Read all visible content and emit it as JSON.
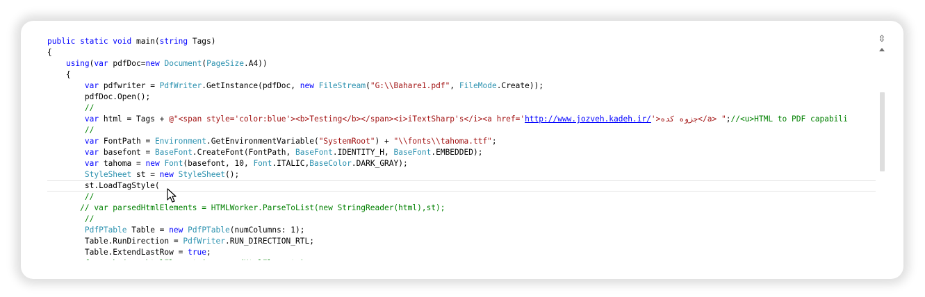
{
  "editor": {
    "lines": [
      [
        {
          "t": "public static void",
          "c": "kw"
        },
        {
          "t": " main("
        },
        {
          "t": "string",
          "c": "kw"
        },
        {
          "t": " Tags)"
        }
      ],
      [
        {
          "t": "{"
        }
      ],
      [
        {
          "t": "    "
        },
        {
          "t": "using",
          "c": "kw"
        },
        {
          "t": "("
        },
        {
          "t": "var",
          "c": "kw"
        },
        {
          "t": " pdfDoc="
        },
        {
          "t": "new",
          "c": "kw"
        },
        {
          "t": " "
        },
        {
          "t": "Document",
          "c": "ty"
        },
        {
          "t": "("
        },
        {
          "t": "PageSize",
          "c": "ty"
        },
        {
          "t": ".A4))"
        }
      ],
      [
        {
          "t": "    {"
        }
      ],
      [
        {
          "t": "        "
        },
        {
          "t": "var",
          "c": "kw"
        },
        {
          "t": " pdfwriter = "
        },
        {
          "t": "PdfWriter",
          "c": "ty"
        },
        {
          "t": ".GetInstance(pdfDoc, "
        },
        {
          "t": "new",
          "c": "kw"
        },
        {
          "t": " "
        },
        {
          "t": "FileStream",
          "c": "ty"
        },
        {
          "t": "("
        },
        {
          "t": "\"G:\\\\Bahare1.pdf\"",
          "c": "str"
        },
        {
          "t": ", "
        },
        {
          "t": "FileMode",
          "c": "ty"
        },
        {
          "t": ".Create));"
        }
      ],
      [
        {
          "t": "        pdfDoc.Open();"
        }
      ],
      [
        {
          "t": "        "
        },
        {
          "t": "//",
          "c": "cm"
        }
      ],
      [
        {
          "t": "        "
        },
        {
          "t": "var",
          "c": "kw"
        },
        {
          "t": " html = Tags + "
        },
        {
          "t": "@\"<span style='color:blue'><b>Testing</b></span><i>iTextSharp's</i><a href='",
          "c": "str"
        },
        {
          "t": "http://www.jozveh.kadeh.ir/",
          "c": "lnk"
        },
        {
          "t": "'>جزوه کده</a> \"",
          "c": "str"
        },
        {
          "t": ";"
        },
        {
          "t": "//<u>HTML to PDF capabili",
          "c": "cm"
        }
      ],
      [
        {
          "t": "        "
        },
        {
          "t": "//",
          "c": "cm"
        }
      ],
      [
        {
          "t": "        "
        },
        {
          "t": "var",
          "c": "kw"
        },
        {
          "t": " FontPath = "
        },
        {
          "t": "Environment",
          "c": "ty"
        },
        {
          "t": ".GetEnvironmentVariable("
        },
        {
          "t": "\"SystemRoot\"",
          "c": "str"
        },
        {
          "t": ") + "
        },
        {
          "t": "\"\\\\fonts\\\\tahoma.ttf\"",
          "c": "str"
        },
        {
          "t": ";"
        }
      ],
      [
        {
          "t": "        "
        },
        {
          "t": "var",
          "c": "kw"
        },
        {
          "t": " basefont = "
        },
        {
          "t": "BaseFont",
          "c": "ty"
        },
        {
          "t": ".CreateFont(FontPath, "
        },
        {
          "t": "BaseFont",
          "c": "ty"
        },
        {
          "t": ".IDENTITY_H, "
        },
        {
          "t": "BaseFont",
          "c": "ty"
        },
        {
          "t": ".EMBEDDED);"
        }
      ],
      [
        {
          "t": "        "
        },
        {
          "t": "var",
          "c": "kw"
        },
        {
          "t": " tahoma = "
        },
        {
          "t": "new",
          "c": "kw"
        },
        {
          "t": " "
        },
        {
          "t": "Font",
          "c": "ty"
        },
        {
          "t": "(basefont, 10, "
        },
        {
          "t": "Font",
          "c": "ty"
        },
        {
          "t": ".ITALIC,"
        },
        {
          "t": "BaseColor",
          "c": "ty"
        },
        {
          "t": ".DARK_GRAY);"
        }
      ],
      [
        {
          "t": "        "
        },
        {
          "t": "StyleSheet",
          "c": "ty"
        },
        {
          "t": " st = "
        },
        {
          "t": "new",
          "c": "kw"
        },
        {
          "t": " "
        },
        {
          "t": "StyleSheet",
          "c": "ty"
        },
        {
          "t": "();"
        }
      ],
      [
        {
          "t": "        st.LoadTagStyle("
        }
      ],
      [
        {
          "t": "        "
        },
        {
          "t": "//",
          "c": "cm"
        }
      ],
      [
        {
          "t": "       "
        },
        {
          "t": "// var parsedHtmlElements = HTMLWorker.ParseToList(new StringReader(html),st);",
          "c": "cm"
        }
      ],
      [
        {
          "t": "        "
        },
        {
          "t": "//",
          "c": "cm"
        }
      ],
      [
        {
          "t": "        "
        },
        {
          "t": "PdfPTable",
          "c": "ty"
        },
        {
          "t": " Table = "
        },
        {
          "t": "new",
          "c": "kw"
        },
        {
          "t": " "
        },
        {
          "t": "PdfPTable",
          "c": "ty"
        },
        {
          "t": "(numColumns: 1);"
        }
      ],
      [
        {
          "t": "        Table.RunDirection = "
        },
        {
          "t": "PdfWriter",
          "c": "ty"
        },
        {
          "t": ".RUN_DIRECTION_RTL;"
        }
      ],
      [
        {
          "t": "        Table.ExtendLastRow = "
        },
        {
          "t": "true",
          "c": "kw"
        },
        {
          "t": ";"
        }
      ],
      [
        {
          "t": "        "
        },
        {
          "t": "foreach (var htmlElement in parsedHtmlElements)",
          "c": "cm"
        }
      ]
    ],
    "current_line": 13
  },
  "icons": {
    "split": "split-handle-icon",
    "scroll_up": "arrow-up-icon",
    "cursor": "mouse-pointer-icon"
  },
  "colors": {
    "keyword": "#0000ff",
    "type": "#2b91af",
    "string": "#a31515",
    "comment": "#008000"
  }
}
